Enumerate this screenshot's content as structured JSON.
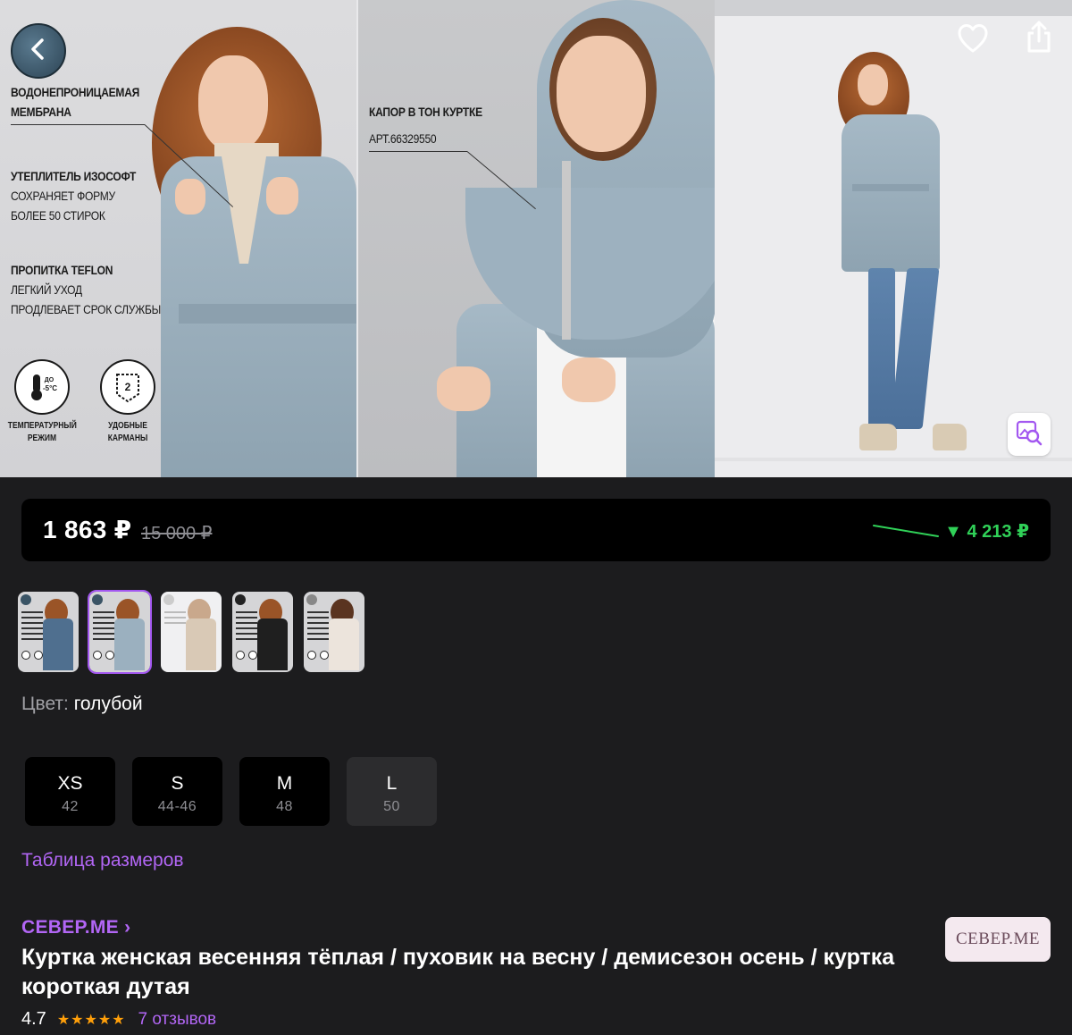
{
  "gallery": {
    "panel1": {
      "callout_1_line1": "ВОДОНЕПРОНИЦАЕМАЯ",
      "callout_1_line2": "МЕМБРАНА",
      "callout_2_title": "УТЕПЛИТЕЛЬ ИЗОСОФТ",
      "callout_2_line1": "СОХРАНЯЕТ ФОРМУ",
      "callout_2_line2": "БОЛЕЕ 50 СТИРОК",
      "callout_3_title": "ПРОПИТКА TEFLON",
      "callout_3_line1": "ЛЕГКИЙ УХОД",
      "callout_3_line2": "ПРОДЛЕВАЕТ СРОК СЛУЖБЫ",
      "badge_temp_top": "ДО",
      "badge_temp_value": "-5°C",
      "badge_temp_cap1": "ТЕМПЕРАТУРНЫЙ",
      "badge_temp_cap2": "РЕЖИМ",
      "badge_pocket_number": "2",
      "badge_pocket_cap1": "УДОБНЫЕ",
      "badge_pocket_cap2": "КАРМАНЫ"
    },
    "panel2": {
      "callout_line1": "КАПОР В ТОН КУРТКЕ",
      "callout_line2": "АРТ.66329550"
    }
  },
  "icons": {
    "back": "chevron-left-icon",
    "favorite": "heart-icon",
    "share": "share-icon",
    "image_search": "image-search-icon"
  },
  "price": {
    "current": "1 863 ₽",
    "old": "15 000 ₽",
    "drop": "▼ 4 213 ₽"
  },
  "thumbnails": [
    {
      "coat_color": "#4f6f8f",
      "selected": false
    },
    {
      "coat_color": "#9bb0bf",
      "selected": true
    },
    {
      "coat_color": "#d9c9b6",
      "selected": false
    },
    {
      "coat_color": "#1f1f1f",
      "selected": false
    },
    {
      "coat_color": "#ece4dc",
      "selected": false
    }
  ],
  "color": {
    "label": "Цвет:",
    "value": "голубой"
  },
  "sizes": [
    {
      "label": "XS",
      "ru": "42",
      "available": true
    },
    {
      "label": "S",
      "ru": "44-46",
      "available": true
    },
    {
      "label": "M",
      "ru": "48",
      "available": true
    },
    {
      "label": "L",
      "ru": "50",
      "available": false
    }
  ],
  "size_table_link": "Таблица размеров",
  "product": {
    "brand": "СЕВЕР.МЕ ›",
    "brand_logo": "СЕВЕР.МЕ",
    "title": "Куртка женская весенняя тёплая / пуховик на весну / демисезон осень / куртка короткая дутая",
    "rating": "4.7",
    "stars": "★★★★★",
    "reviews": "7 отзывов"
  },
  "colors": {
    "background": "#1c1c1e",
    "accent": "#b266f5",
    "price_drop": "#30d158",
    "stars": "#ff9f0a"
  }
}
